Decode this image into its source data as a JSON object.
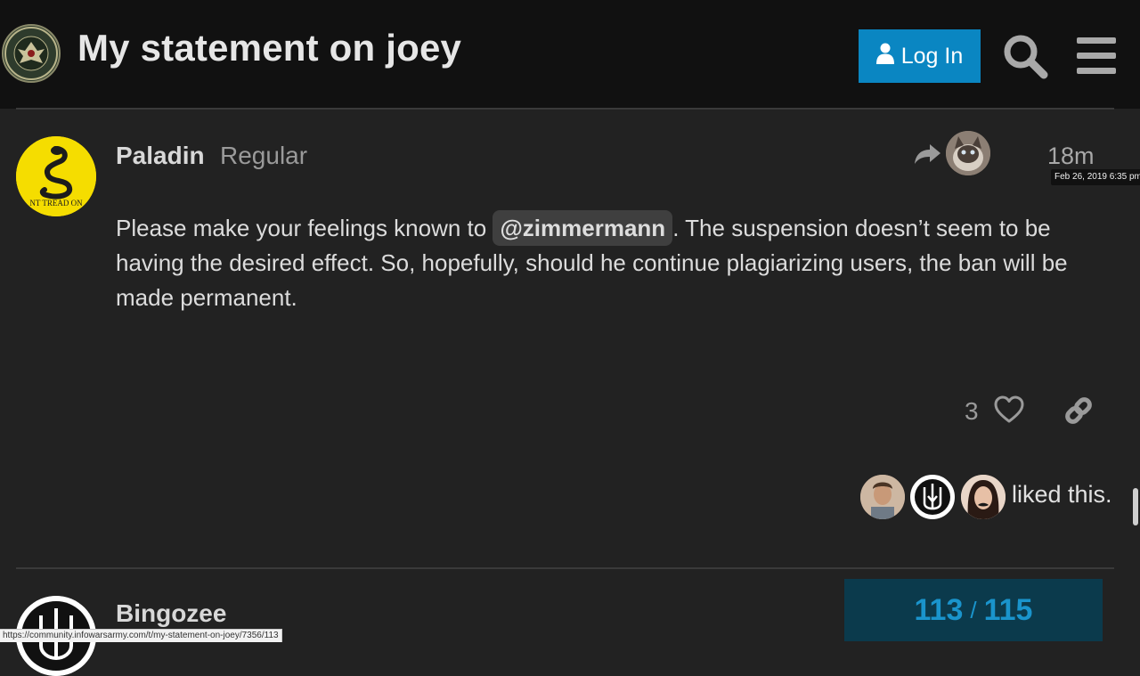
{
  "topic": {
    "title": "My statement on joey"
  },
  "header": {
    "login_label": "Log In"
  },
  "post": {
    "username": "Paladin",
    "user_title": "Regular",
    "time": "18m",
    "time_tooltip": "Feb 26, 2019 6:35 pm",
    "body_before": "Please make your feelings known to ",
    "mention": "@zimmermann",
    "body_after": ". The suspension doesn’t seem to be having the desired effect. So, hopefully, should he continue plagiarizing users, the ban will be made permanent.",
    "like_count": "3",
    "liked_text": "liked this.",
    "avatar_text": "NT TREAD ON"
  },
  "next_post": {
    "username": "Bingozee"
  },
  "progress": {
    "current": "113",
    "separator": "/",
    "total": "115"
  },
  "status_bar": {
    "url": "https://community.infowarsarmy.com/t/my-statement-on-joey/7356/113"
  },
  "colors": {
    "accent": "#0a86c2",
    "background": "#222222",
    "header": "#111111",
    "progress_bg": "#0b3a4c"
  },
  "icons": [
    "user-icon",
    "search-icon",
    "hamburger-menu-icon",
    "reply-arrow-icon",
    "heart-icon",
    "link-icon"
  ]
}
